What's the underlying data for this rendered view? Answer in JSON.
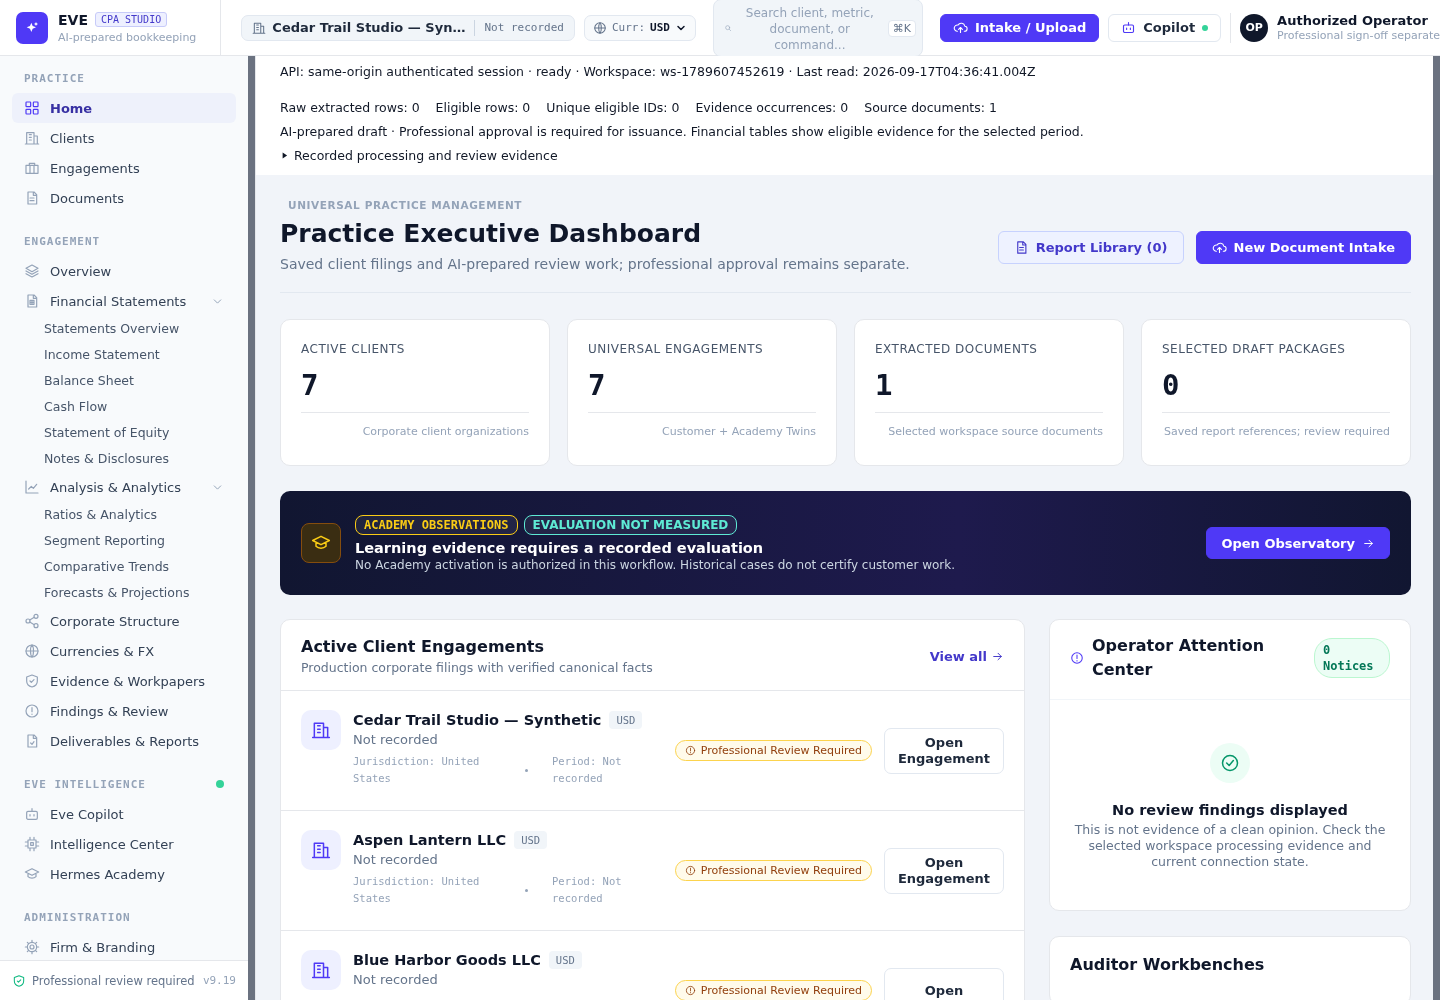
{
  "brand": {
    "name": "EVE",
    "tag": "CPA STUDIO",
    "subtitle": "AI-prepared bookkeeping"
  },
  "topbar": {
    "client": {
      "name": "Cedar Trail Studio — Syn…",
      "period": "Not recorded"
    },
    "currency": {
      "label": "Curr:",
      "value": "USD"
    },
    "search": {
      "placeholder": "Search client, metric, document, or command...",
      "shortcut": "⌘K"
    },
    "upload_button": "Intake / Upload",
    "copilot": {
      "label": "Copilot",
      "online": true
    },
    "user": {
      "initials": "OP",
      "name": "Authorized Operator",
      "role": "Professional sign-off separate"
    }
  },
  "sidebar": {
    "sections": [
      {
        "label": "PRACTICE",
        "online": false,
        "items": [
          {
            "label": "Home",
            "selected": true
          },
          {
            "label": "Clients",
            "selected": false
          },
          {
            "label": "Engagements",
            "selected": false
          },
          {
            "label": "Documents",
            "selected": false
          }
        ]
      },
      {
        "label": "ENGAGEMENT",
        "online": false,
        "items": [
          {
            "label": "Overview",
            "selected": false
          },
          {
            "label": "Financial Statements",
            "selected": false,
            "expanded": true,
            "children": [
              {
                "label": "Statements Overview",
                "selected": false
              },
              {
                "label": "Income Statement",
                "selected": false
              },
              {
                "label": "Balance Sheet",
                "selected": false
              },
              {
                "label": "Cash Flow",
                "selected": false
              },
              {
                "label": "Statement of Equity",
                "selected": false
              },
              {
                "label": "Notes & Disclosures",
                "selected": false
              }
            ]
          },
          {
            "label": "Analysis & Analytics",
            "selected": false,
            "expanded": true,
            "children": [
              {
                "label": "Ratios & Analytics",
                "selected": false
              },
              {
                "label": "Segment Reporting",
                "selected": false
              },
              {
                "label": "Comparative Trends",
                "selected": false
              },
              {
                "label": "Forecasts & Projections",
                "selected": false
              }
            ]
          },
          {
            "label": "Corporate Structure",
            "selected": false
          },
          {
            "label": "Currencies & FX",
            "selected": false
          },
          {
            "label": "Evidence & Workpapers",
            "selected": false
          },
          {
            "label": "Findings & Review",
            "selected": false
          },
          {
            "label": "Deliverables & Reports",
            "selected": false
          }
        ]
      },
      {
        "label": "EVE INTELLIGENCE",
        "online": true,
        "items": [
          {
            "label": "Eve Copilot",
            "selected": false
          },
          {
            "label": "Intelligence Center",
            "selected": false
          },
          {
            "label": "Hermes Academy",
            "selected": false
          }
        ]
      },
      {
        "label": "ADMINISTRATION",
        "online": false,
        "items": [
          {
            "label": "Firm & Branding",
            "selected": false
          }
        ]
      }
    ],
    "footer": {
      "status": "Professional review required",
      "version": "v9.19"
    }
  },
  "info": {
    "api": "API: same-origin authenticated session · ready · Workspace: ws-1789607452619 · Last read: 2026-09-17T04:36:41.004Z",
    "stats": [
      "Raw extracted rows: 0",
      "Eligible rows: 0",
      "Unique eligible IDs: 0",
      "Evidence occurrences: 0",
      "Source documents: 1"
    ],
    "notice": "AI-prepared draft · Professional approval is required for issuance. Financial tables show eligible evidence for the selected period.",
    "details": {
      "label": "Recorded processing and review evidence",
      "expanded": false
    }
  },
  "header": {
    "eyebrow": "UNIVERSAL PRACTICE MANAGEMENT",
    "title": "Practice Executive Dashboard",
    "subtitle": "Saved client filings and AI-prepared review work; professional approval remains separate.",
    "buttons": [
      {
        "label": "Report Library (0)",
        "kind": "secondary"
      },
      {
        "label": "New Document Intake",
        "kind": "primary"
      }
    ]
  },
  "metrics": [
    {
      "label": "ACTIVE CLIENTS",
      "value": "7",
      "note": "Corporate client organizations"
    },
    {
      "label": "UNIVERSAL ENGAGEMENTS",
      "value": "7",
      "note": "Customer + Academy Twins"
    },
    {
      "label": "EXTRACTED DOCUMENTS",
      "value": "1",
      "note": "Selected workspace source documents"
    },
    {
      "label": "SELECTED DRAFT PACKAGES",
      "value": "0",
      "note": "Saved report references; review required"
    }
  ],
  "banner": {
    "badges": [
      {
        "label": "ACADEMY OBSERVATIONS",
        "color": "#facc15"
      },
      {
        "label": "EVALUATION NOT MEASURED",
        "color": "#5eead4"
      }
    ],
    "title": "Learning evidence requires a recorded evaluation",
    "text": "No Academy activation is authorized in this workflow. Historical cases do not certify customer work.",
    "button": "Open Observatory"
  },
  "engagements": {
    "title": "Active Client Engagements",
    "subtitle": "Production corporate filings with verified canonical facts",
    "link": "View all",
    "rows": [
      {
        "name": "Cedar Trail Studio — Synthetic",
        "currency": "USD",
        "status": "Not recorded",
        "jurisdiction": "Jurisdiction: United States",
        "period": "Period: Not recorded",
        "badge": "Professional Review Required",
        "button": "Open Engagement"
      },
      {
        "name": "Aspen Lantern LLC",
        "currency": "USD",
        "status": "Not recorded",
        "jurisdiction": "Jurisdiction: United States",
        "period": "Period: Not recorded",
        "badge": "Professional Review Required",
        "button": "Open Engagement"
      },
      {
        "name": "Blue Harbor Goods LLC",
        "currency": "USD",
        "status": "Not recorded",
        "badge": "Professional Review Required",
        "button": "Open"
      }
    ]
  },
  "attention": {
    "title": "Operator Attention Center",
    "count": "0 Notices",
    "empty_title": "No review findings displayed",
    "empty_text": "This is not evidence of a clean opinion. Check the selected workspace processing evidence and current connection state."
  },
  "workbenches": {
    "title": "Auditor Workbenches"
  }
}
